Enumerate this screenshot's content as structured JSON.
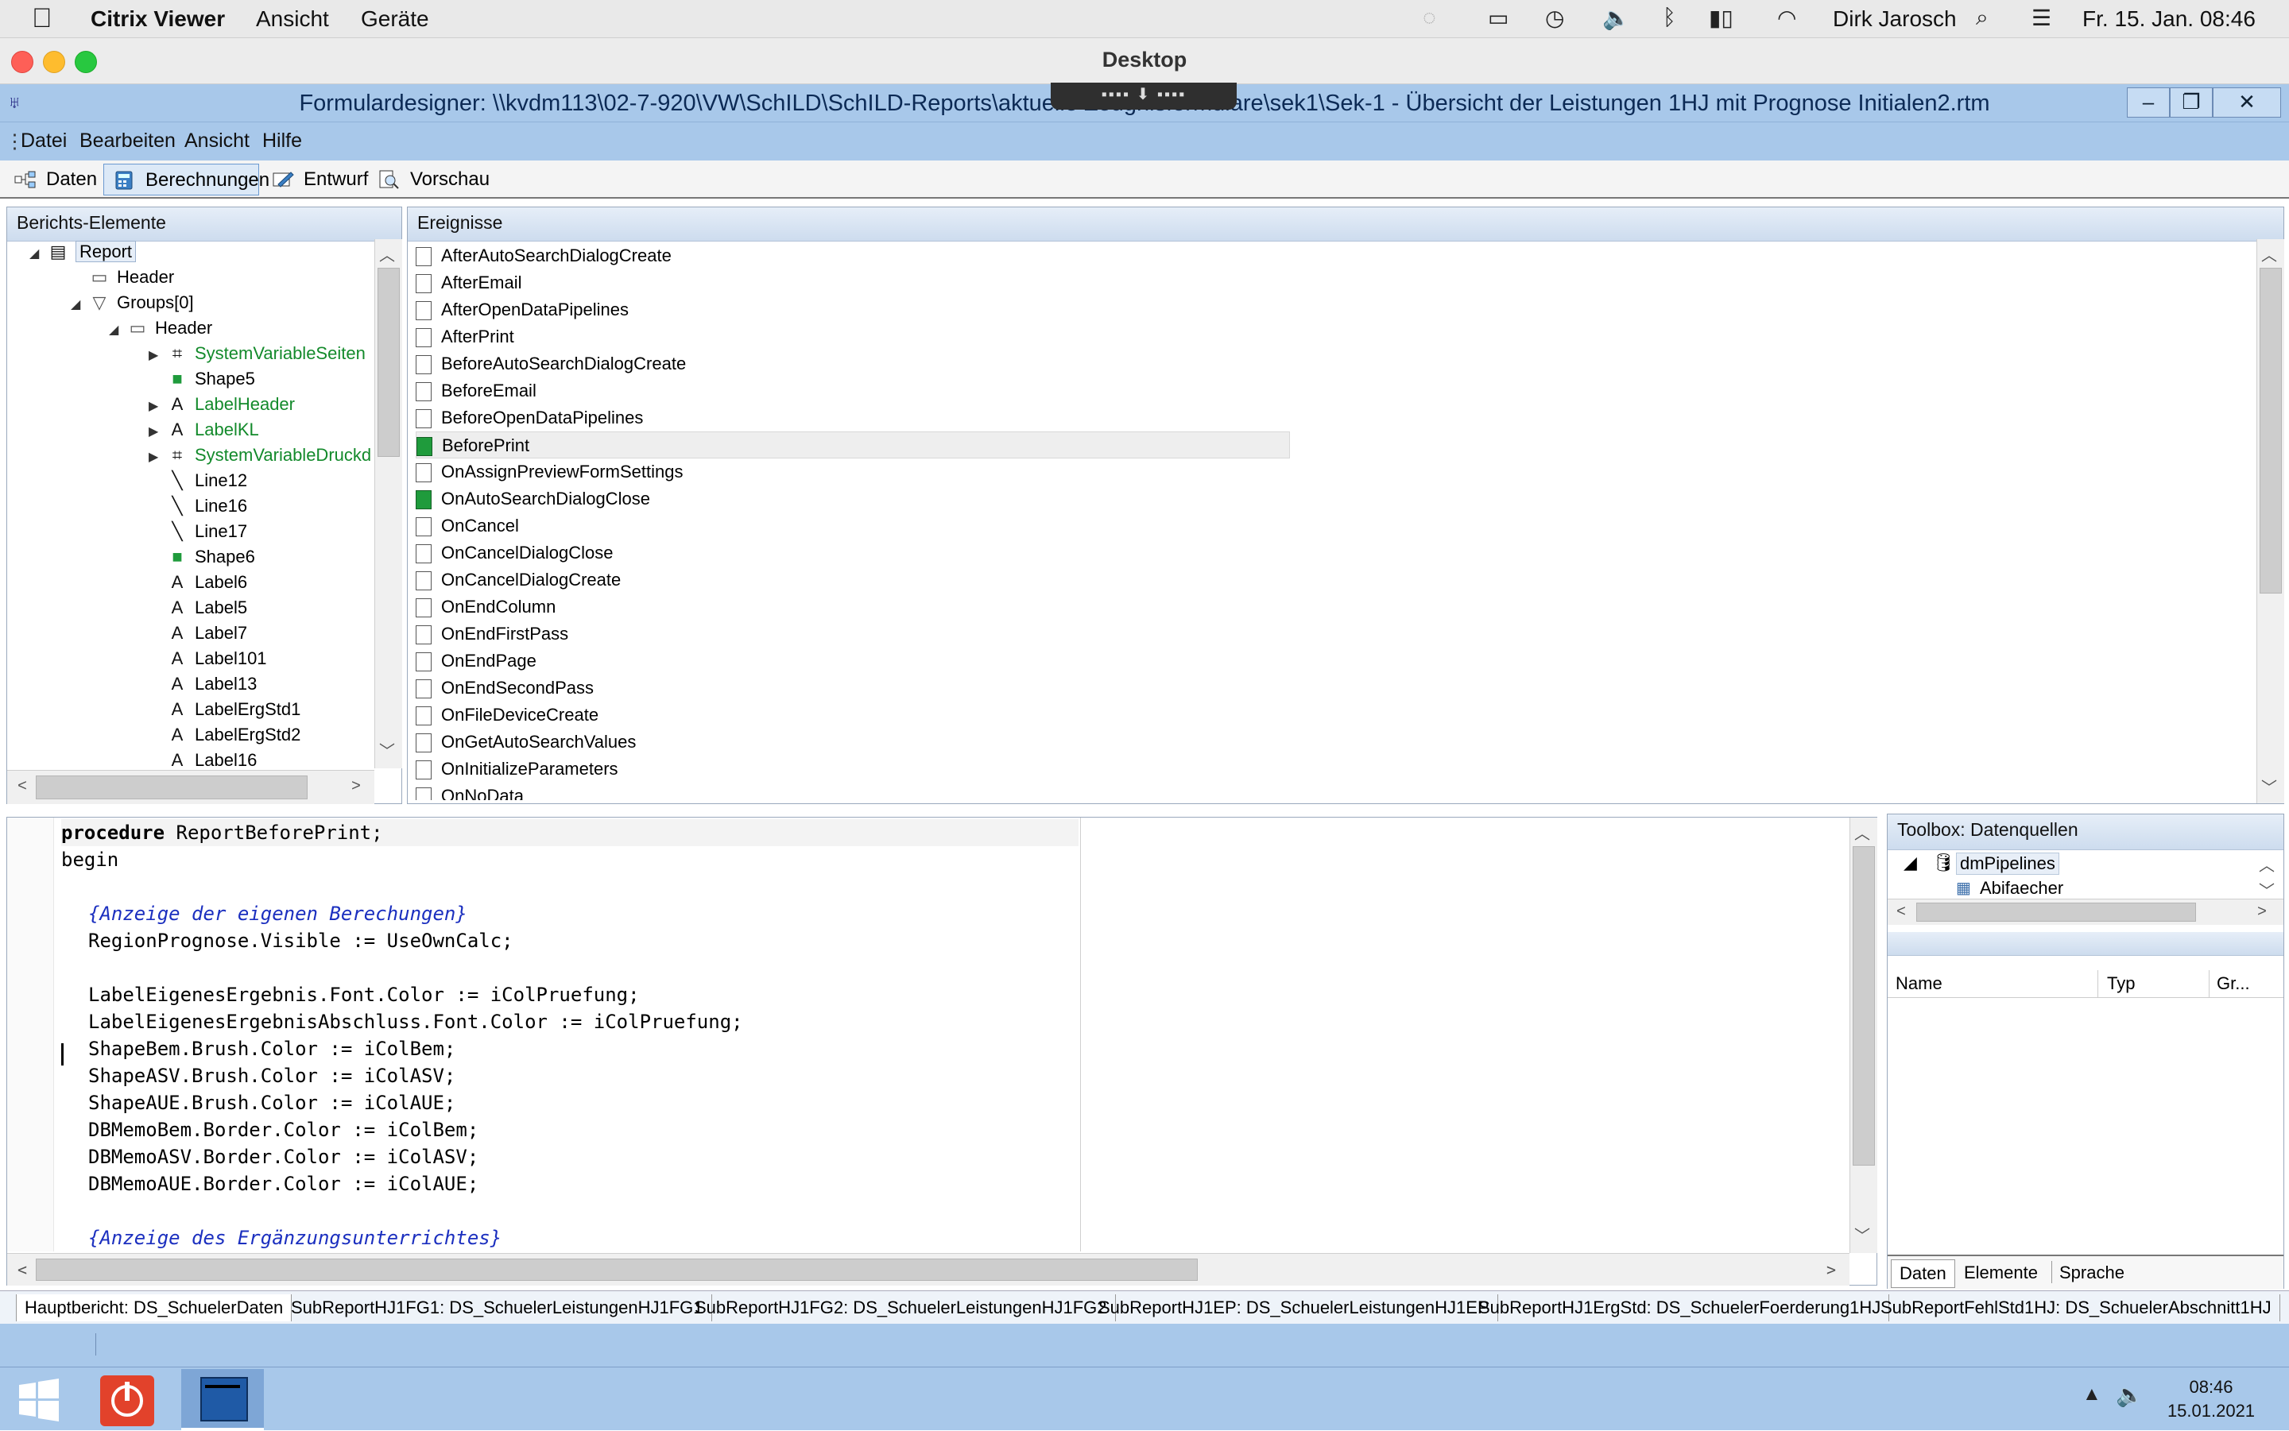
{
  "mac_menubar": {
    "app_name": "Citrix Viewer",
    "menus": [
      "Ansicht",
      "Geräte"
    ],
    "user": "Dirk Jarosch",
    "clock": "Fr. 15. Jan.  08:46"
  },
  "mac_window": {
    "title": "Desktop"
  },
  "app": {
    "title": "Formulardesigner: \\\\kvdm113\\02-7-920\\VW\\SchILD\\SchILD-Reports\\aktuelle Zeugnisformulare\\sek1\\Sek-1 - Übersicht der Leistungen 1HJ mit Prognose Initialen2.rtm",
    "menu": [
      "Datei",
      "Bearbeiten",
      "Ansicht",
      "Hilfe"
    ],
    "tabs": [
      "Daten",
      "Berechnungen",
      "Entwurf",
      "Vorschau"
    ],
    "active_tab": "Berechnungen"
  },
  "tree": {
    "header": "Berichts-Elemente",
    "items": [
      {
        "label": "Report",
        "depth": 0,
        "icon": "report-icon",
        "green": false
      },
      {
        "label": "Header",
        "depth": 1,
        "icon": "band-icon",
        "green": false
      },
      {
        "label": "Groups[0]",
        "depth": 1,
        "icon": "group-icon",
        "green": false
      },
      {
        "label": "Header",
        "depth": 2,
        "icon": "band-icon",
        "green": false
      },
      {
        "label": "SystemVariableSeiten",
        "depth": 3,
        "icon": "sysvar-icon",
        "green": true
      },
      {
        "label": "Shape5",
        "depth": 3,
        "icon": "shape-icon",
        "green": false
      },
      {
        "label": "LabelHeader",
        "depth": 3,
        "icon": "label-icon",
        "green": true
      },
      {
        "label": "LabelKL",
        "depth": 3,
        "icon": "label-icon",
        "green": true
      },
      {
        "label": "SystemVariableDruckd",
        "depth": 3,
        "icon": "sysvar-icon",
        "green": true
      },
      {
        "label": "Line12",
        "depth": 3,
        "icon": "line-icon",
        "green": false
      },
      {
        "label": "Line16",
        "depth": 3,
        "icon": "line-icon",
        "green": false
      },
      {
        "label": "Line17",
        "depth": 3,
        "icon": "line-icon",
        "green": false
      },
      {
        "label": "Shape6",
        "depth": 3,
        "icon": "shape-icon",
        "green": false
      },
      {
        "label": "Label6",
        "depth": 3,
        "icon": "label-icon",
        "green": false
      },
      {
        "label": "Label5",
        "depth": 3,
        "icon": "label-icon",
        "green": false
      },
      {
        "label": "Label7",
        "depth": 3,
        "icon": "label-icon",
        "green": false
      },
      {
        "label": "Label101",
        "depth": 3,
        "icon": "label-icon",
        "green": false
      },
      {
        "label": "Label13",
        "depth": 3,
        "icon": "label-icon",
        "green": false
      },
      {
        "label": "LabelErgStd1",
        "depth": 3,
        "icon": "label-icon",
        "green": false
      },
      {
        "label": "LabelErgStd2",
        "depth": 3,
        "icon": "label-icon",
        "green": false
      },
      {
        "label": "Label16",
        "depth": 3,
        "icon": "label-icon",
        "green": false
      }
    ]
  },
  "events": {
    "header": "Ereignisse",
    "items": [
      {
        "label": "AfterAutoSearchDialogCreate",
        "has_code": false
      },
      {
        "label": "AfterEmail",
        "has_code": false
      },
      {
        "label": "AfterOpenDataPipelines",
        "has_code": false
      },
      {
        "label": "AfterPrint",
        "has_code": false
      },
      {
        "label": "BeforeAutoSearchDialogCreate",
        "has_code": false
      },
      {
        "label": "BeforeEmail",
        "has_code": false
      },
      {
        "label": "BeforeOpenDataPipelines",
        "has_code": false
      },
      {
        "label": "BeforePrint",
        "has_code": true,
        "selected": true
      },
      {
        "label": "OnAssignPreviewFormSettings",
        "has_code": false
      },
      {
        "label": "OnAutoSearchDialogClose",
        "has_code": true
      },
      {
        "label": "OnCancel",
        "has_code": false
      },
      {
        "label": "OnCancelDialogClose",
        "has_code": false
      },
      {
        "label": "OnCancelDialogCreate",
        "has_code": false
      },
      {
        "label": "OnEndColumn",
        "has_code": false
      },
      {
        "label": "OnEndFirstPass",
        "has_code": false
      },
      {
        "label": "OnEndPage",
        "has_code": false
      },
      {
        "label": "OnEndSecondPass",
        "has_code": false
      },
      {
        "label": "OnFileDeviceCreate",
        "has_code": false
      },
      {
        "label": "OnGetAutoSearchValues",
        "has_code": false
      },
      {
        "label": "OnInitializeParameters",
        "has_code": false
      },
      {
        "label": "OnNoData",
        "has_code": false
      }
    ]
  },
  "code": {
    "lines": [
      {
        "text": "procedure ReportBeforePrint;",
        "kind": "kw-line",
        "indent": 0
      },
      {
        "text": "begin",
        "kind": "plain",
        "indent": 0
      },
      {
        "text": "",
        "kind": "plain",
        "indent": 0
      },
      {
        "text": "{Anzeige der eigenen Berechungen}",
        "kind": "comment",
        "indent": 1
      },
      {
        "text": "RegionPrognose.Visible := UseOwnCalc;",
        "kind": "plain",
        "indent": 1
      },
      {
        "text": "",
        "kind": "plain",
        "indent": 0
      },
      {
        "text": "LabelEigenesErgebnis.Font.Color := iColPruefung;",
        "kind": "plain",
        "indent": 1
      },
      {
        "text": "LabelEigenesErgebnisAbschluss.Font.Color := iColPruefung;",
        "kind": "plain",
        "indent": 1
      },
      {
        "text": "ShapeBem.Brush.Color := iColBem;",
        "kind": "plain",
        "indent": 1
      },
      {
        "text": "ShapeASV.Brush.Color := iColASV;",
        "kind": "plain",
        "indent": 1
      },
      {
        "text": "ShapeAUE.Brush.Color := iColAUE;",
        "kind": "plain",
        "indent": 1
      },
      {
        "text": "DBMemoBem.Border.Color := iColBem;",
        "kind": "plain",
        "indent": 1
      },
      {
        "text": "DBMemoASV.Border.Color := iColASV;",
        "kind": "plain",
        "indent": 1
      },
      {
        "text": "DBMemoAUE.Border.Color := iColAUE;",
        "kind": "plain",
        "indent": 1
      },
      {
        "text": "",
        "kind": "plain",
        "indent": 0
      },
      {
        "text": "{Anzeige des Ergänzungsunterrichtes}",
        "kind": "comment",
        "indent": 1
      }
    ]
  },
  "toolbox": {
    "header": "Toolbox: Datenquellen",
    "tree": [
      "dmPipelines",
      "Abifaecher"
    ],
    "columns": [
      "Name",
      "Typ",
      "Gr..."
    ],
    "tabs": [
      "Daten",
      "Elemente",
      "Sprache"
    ]
  },
  "subreport_tabs": [
    "Hauptbericht: DS_SchuelerDaten",
    "SubReportHJ1FG1: DS_SchuelerLeistungenHJ1FG1",
    "SubReportHJ1FG2: DS_SchuelerLeistungenHJ1FG2",
    "SubReportHJ1EP: DS_SchuelerLeistungenHJ1EP",
    "SubReportHJ1ErgStd: DS_SchuelerFoerderung1HJ",
    "SubReportFehlStd1HJ: DS_SchuelerAbschnitt1HJ"
  ],
  "taskbar": {
    "time": "08:46",
    "date": "15.01.2021"
  },
  "colors": {
    "accent": "#a8c8ea",
    "green_text": "#138a2b",
    "comment": "#1b2fbf"
  }
}
